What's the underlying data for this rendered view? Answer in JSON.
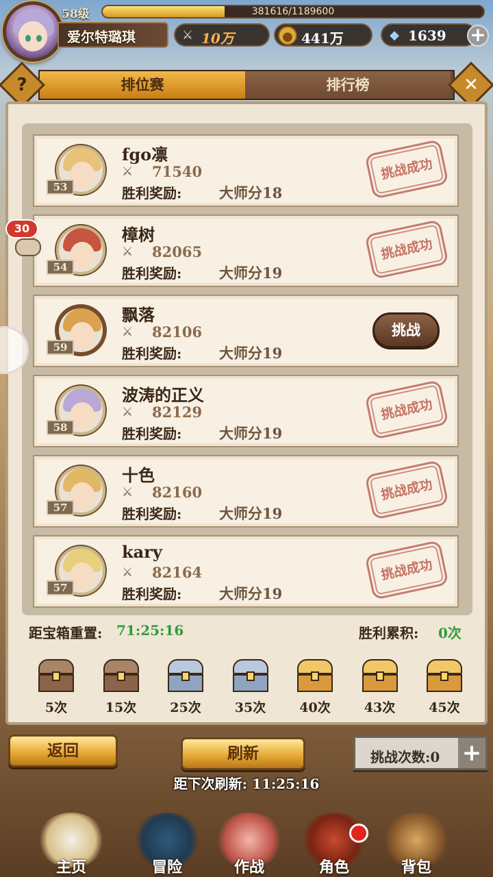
{
  "player": {
    "level": "58级",
    "name": "爱尔特璐琪",
    "exp_text": "381616/1189600",
    "exp_fraction": 0.32,
    "power": "10万",
    "gold": "441万",
    "gems": "1639"
  },
  "tabs": {
    "ranked": "排位赛",
    "leaderboard": "排行榜",
    "help_glyph": "?",
    "close_glyph": "✕"
  },
  "reward_label": "胜利奖励:",
  "opponents": [
    {
      "name": "fgo凛",
      "level": "53",
      "power": "71540",
      "reward": "大师分18",
      "status": "挑战成功"
    },
    {
      "name": "樟树",
      "level": "54",
      "power": "82065",
      "reward": "大师分19",
      "status": "挑战成功"
    },
    {
      "name": "飘落",
      "level": "59",
      "power": "82106",
      "reward": "大师分19",
      "status": "挑战"
    },
    {
      "name": "波涛的正义",
      "level": "58",
      "power": "82129",
      "reward": "大师分19",
      "status": "挑战成功"
    },
    {
      "name": "十色",
      "level": "57",
      "power": "82160",
      "reward": "大师分19",
      "status": "挑战成功"
    },
    {
      "name": "kary",
      "level": "57",
      "power": "82164",
      "reward": "大师分19",
      "status": "挑战成功"
    }
  ],
  "chest_reset": {
    "label": "距宝箱重置:",
    "time": "71:25:16"
  },
  "wins": {
    "label": "胜利累积:",
    "count": "0次"
  },
  "chests": [
    {
      "label": "5次",
      "tier": "bronze"
    },
    {
      "label": "15次",
      "tier": "bronze"
    },
    {
      "label": "25次",
      "tier": "silver"
    },
    {
      "label": "35次",
      "tier": "silver"
    },
    {
      "label": "40次",
      "tier": "gold"
    },
    {
      "label": "43次",
      "tier": "gold"
    },
    {
      "label": "45次",
      "tier": "gold"
    }
  ],
  "buttons": {
    "back": "返回",
    "refresh": "刷新",
    "challenge_count": "挑战次数:0"
  },
  "refresh_timer": "距下次刷新: 11:25:16",
  "chat": {
    "unread": "30"
  },
  "nav": [
    {
      "label": "主页",
      "icon": "home-icon"
    },
    {
      "label": "冒险",
      "icon": "adventure-icon"
    },
    {
      "label": "作战",
      "icon": "battle-icon"
    },
    {
      "label": "角色",
      "icon": "character-icon"
    },
    {
      "label": "背包",
      "icon": "backpack-icon"
    }
  ],
  "colors": {
    "accent_gold": "#e4a62f",
    "success_green": "#2f9b3c",
    "stamp_red": "#c05a50"
  }
}
